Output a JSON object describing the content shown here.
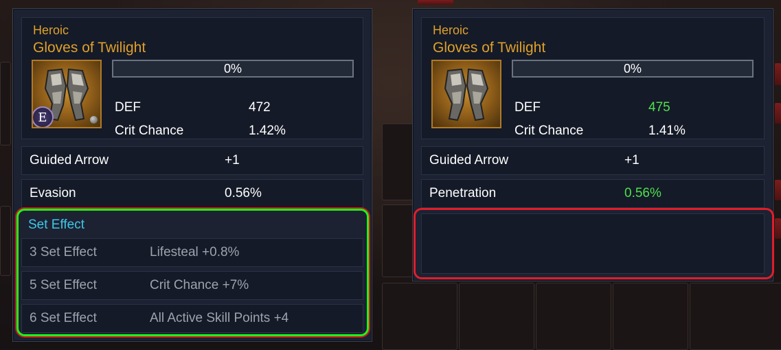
{
  "colors": {
    "rarity": "#e0a02a",
    "set_title": "#3ec8ea",
    "increase": "#4ee04e",
    "green_highlight": "#1cf71c",
    "red_highlight": "#e01e2a"
  },
  "left": {
    "rarity": "Heroic",
    "item_name": "Gloves of Twilight",
    "badge": "E",
    "progress": "0%",
    "stats": [
      {
        "label": "DEF",
        "value": "472"
      },
      {
        "label": "Crit Chance",
        "value": "1.42%"
      }
    ],
    "options": [
      {
        "label": "Guided Arrow",
        "value": "+1"
      },
      {
        "label": "Evasion",
        "value": "0.56%"
      }
    ],
    "set_title": "Set Effect",
    "set_effects": [
      {
        "label": "3 Set Effect",
        "value": "Lifesteal +0.8%"
      },
      {
        "label": "5 Set Effect",
        "value": "Crit Chance +7%"
      },
      {
        "label": "6 Set Effect",
        "value": "All Active Skill Points +4"
      }
    ]
  },
  "right": {
    "rarity": "Heroic",
    "item_name": "Gloves of Twilight",
    "progress": "0%",
    "stats": [
      {
        "label": "DEF",
        "value": "475"
      },
      {
        "label": "Crit Chance",
        "value": "1.41%"
      }
    ],
    "options": [
      {
        "label": "Guided Arrow",
        "value": "+1"
      },
      {
        "label": "Penetration",
        "value": "0.56%"
      }
    ]
  }
}
